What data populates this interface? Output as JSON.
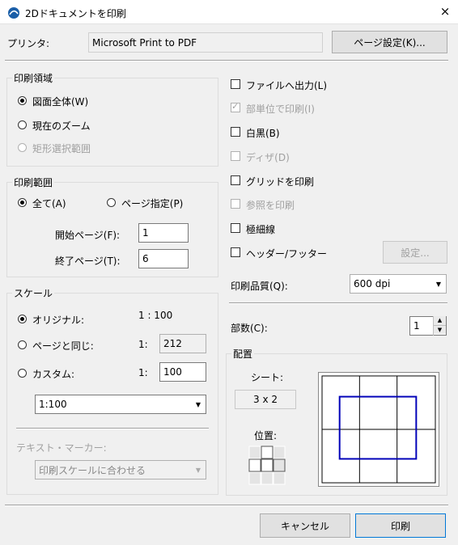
{
  "window": {
    "title": "2Dドキュメントを印刷",
    "close_icon": "×"
  },
  "printer": {
    "label": "プリンタ:",
    "value": "Microsoft Print to PDF",
    "setup_button": "ページ設定(K)..."
  },
  "print_area": {
    "title": "印刷領域",
    "options": [
      "図面全体(W)",
      "現在のズーム",
      "矩形選択範囲"
    ]
  },
  "print_range": {
    "title": "印刷範囲",
    "all": "全て(A)",
    "pages": "ページ指定(P)",
    "start_label": "開始ページ(F):",
    "start_value": "1",
    "end_label": "終了ページ(T):",
    "end_value": "6"
  },
  "scale": {
    "title": "スケール",
    "original_label": "オリジナル:",
    "original_value": "1 : 100",
    "same_as_page_label": "ページと同じ:",
    "same_as_page_prefix": "1:",
    "same_as_page_value": "212",
    "custom_label": "カスタム:",
    "custom_prefix": "1:",
    "custom_value": "100",
    "preset_value": "1:100",
    "text_marker_label": "テキスト・マーカー:",
    "text_marker_value": "印刷スケールに合わせる"
  },
  "options": {
    "print_to_file": "ファイルへ出力(L)",
    "print_by_part": "部単位で印刷(I)",
    "black_white": "白黒(B)",
    "dither": "ディザ(D)",
    "print_grid": "グリッドを印刷",
    "print_references": "参照を印刷",
    "hairline": "極細線",
    "header_footer": "ヘッダー/フッター",
    "settings_button": "設定..."
  },
  "quality": {
    "label": "印刷品質(Q):",
    "value": "600 dpi"
  },
  "copies": {
    "label": "部数(C):",
    "value": "1"
  },
  "placement": {
    "title": "配置",
    "sheet_label": "シート:",
    "sheet_value": "3 x 2",
    "position_label": "位置:"
  },
  "footer": {
    "cancel": "キャンセル",
    "print": "印刷"
  },
  "colors": {
    "accent_frame": "#0000b8"
  }
}
